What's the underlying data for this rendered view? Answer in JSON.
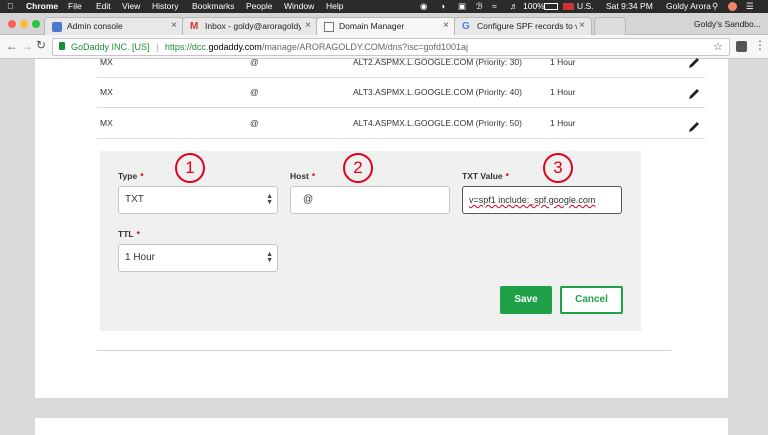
{
  "menubar": {
    "app": "Chrome",
    "items": [
      "File",
      "Edit",
      "View",
      "History",
      "Bookmarks",
      "People",
      "Window",
      "Help"
    ],
    "battery": "100%",
    "input_source": "U.S.",
    "clock": "Sat 9:34 PM",
    "user": "Goldy Arora"
  },
  "tabs": [
    {
      "title": "Admin console",
      "icon": "admin-icon"
    },
    {
      "title": "Inbox - goldy@aroragoldy.com",
      "icon": "gmail-icon"
    },
    {
      "title": "Domain Manager",
      "icon": "page-icon",
      "active": true
    },
    {
      "title": "Configure SPF records to work",
      "icon": "google-icon"
    }
  ],
  "profile": "Goldy's Sandbo...",
  "address": {
    "secure_label": "GoDaddy INC. [US]",
    "url_prefix": "https://dcc.",
    "url_host": "godaddy.com",
    "url_path": "/manage/ARORAGOLDY.COM/dns?isc=gofd1001aj"
  },
  "records": [
    {
      "type": "MX",
      "host": "@",
      "value": "ALT2.ASPMX.L.GOOGLE.COM (Priority: 30)",
      "ttl": "1 Hour"
    },
    {
      "type": "MX",
      "host": "@",
      "value": "ALT3.ASPMX.L.GOOGLE.COM (Priority: 40)",
      "ttl": "1 Hour"
    },
    {
      "type": "MX",
      "host": "@",
      "value": "ALT4.ASPMX.L.GOOGLE.COM (Priority: 50)",
      "ttl": "1 Hour"
    }
  ],
  "form": {
    "type_label": "Type",
    "type_value": "TXT",
    "host_label": "Host",
    "host_value": "@",
    "txt_label": "TXT Value",
    "txt_value": "v=spf1 include:_spf.google.com",
    "ttl_label": "TTL",
    "ttl_value": "1 Hour",
    "required_mark": "*",
    "save": "Save",
    "cancel": "Cancel"
  },
  "annotations": [
    "1",
    "2",
    "3"
  ],
  "colors": {
    "green": "#1fa14a",
    "annotation_red": "#e0001a",
    "required_red": "#d0021b"
  }
}
